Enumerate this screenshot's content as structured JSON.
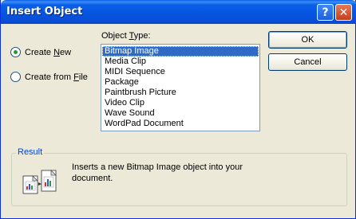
{
  "window": {
    "title": "Insert Object",
    "help_glyph": "?",
    "close_glyph": "✕"
  },
  "options": {
    "create_new": {
      "prefix": "Create ",
      "mnemonic": "N",
      "suffix": "ew",
      "selected": true
    },
    "create_from_file": {
      "prefix": "Create from ",
      "mnemonic": "F",
      "suffix": "ile",
      "selected": false
    }
  },
  "object_type": {
    "label_prefix": "Object ",
    "label_mnemonic": "T",
    "label_suffix": "ype:",
    "items": [
      "Bitmap Image",
      "Media Clip",
      "MIDI Sequence",
      "Package",
      "Paintbrush Picture",
      "Video Clip",
      "Wave Sound",
      "WordPad Document"
    ],
    "selected_index": 0
  },
  "buttons": {
    "ok": "OK",
    "cancel": "Cancel"
  },
  "result": {
    "label": "Result",
    "text": "Inserts a new Bitmap Image object into your document."
  },
  "colors": {
    "title_bar": "#0554e0",
    "selection": "#316ac5",
    "group_label": "#0046d5",
    "radio_dot": "#21a121"
  }
}
